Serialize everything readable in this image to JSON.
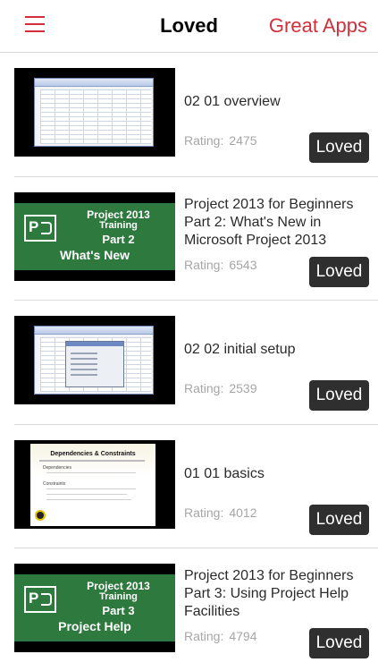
{
  "navbar": {
    "title": "Loved",
    "right_label": "Great Apps",
    "accent_color": "#d32f3a",
    "left_icon": "hamburger-menu-icon"
  },
  "items": [
    {
      "title": "02 01 overview",
      "rating_label": "Rating:",
      "rating": "2475",
      "button": "Loved",
      "thumb": "spreadsheet"
    },
    {
      "title": "Project 2013 for Beginners Part 2: What's New in Microsoft Project 2013",
      "rating_label": "Rating:",
      "rating": "6543",
      "button": "Loved",
      "thumb": "project",
      "thumb_text": {
        "line1": "Project 2013",
        "line2": "Training",
        "line3": "Part 2",
        "line4": "What's New"
      }
    },
    {
      "title": "02 02 initial setup",
      "rating_label": "Rating:",
      "rating": "2539",
      "button": "Loved",
      "thumb": "spreadsheet-dialog"
    },
    {
      "title": "01 01 basics",
      "rating_label": "Rating:",
      "rating": "4012",
      "button": "Loved",
      "thumb": "slide",
      "thumb_text": {
        "heading": "Dependencies & Constraints",
        "b1": "Dependencies",
        "b2": "Constraints"
      }
    },
    {
      "title": "Project 2013 for Beginners Part 3: Using Project Help Facilities",
      "rating_label": "Rating:",
      "rating": "4794",
      "button": "Loved",
      "thumb": "project",
      "thumb_text": {
        "line1": "Project 2013",
        "line2": "Training",
        "line3": "Part 3",
        "line4": "Project Help"
      }
    }
  ]
}
